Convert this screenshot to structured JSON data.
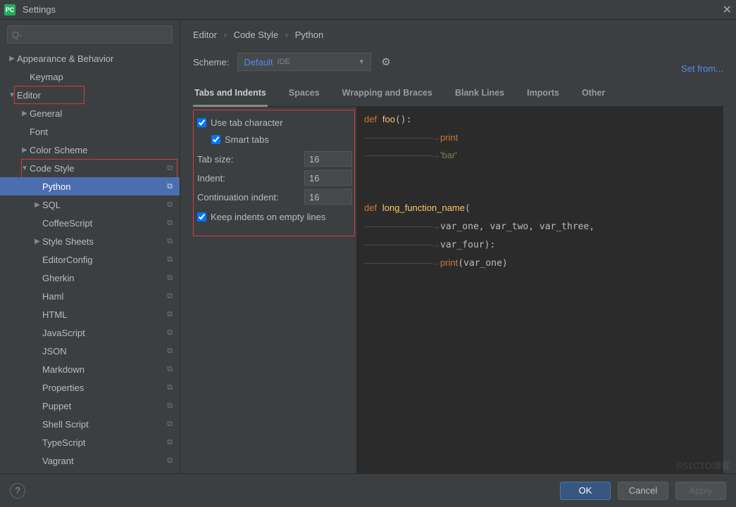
{
  "window": {
    "title": "Settings"
  },
  "search": {
    "placeholder": "Q-"
  },
  "tree": [
    {
      "label": "Appearance & Behavior",
      "depth": 0,
      "arrow": "▶",
      "copy": false,
      "sel": false
    },
    {
      "label": "Keymap",
      "depth": 1,
      "arrow": "",
      "copy": false,
      "sel": false
    },
    {
      "label": "Editor",
      "depth": 0,
      "arrow": "▼",
      "copy": false,
      "sel": false
    },
    {
      "label": "General",
      "depth": 1,
      "arrow": "▶",
      "copy": false,
      "sel": false
    },
    {
      "label": "Font",
      "depth": 1,
      "arrow": "",
      "copy": false,
      "sel": false
    },
    {
      "label": "Color Scheme",
      "depth": 1,
      "arrow": "▶",
      "copy": false,
      "sel": false
    },
    {
      "label": "Code Style",
      "depth": 1,
      "arrow": "▼",
      "copy": true,
      "sel": false
    },
    {
      "label": "Python",
      "depth": 2,
      "arrow": "",
      "copy": true,
      "sel": true
    },
    {
      "label": "SQL",
      "depth": 2,
      "arrow": "▶",
      "copy": true,
      "sel": false
    },
    {
      "label": "CoffeeScript",
      "depth": 2,
      "arrow": "",
      "copy": true,
      "sel": false
    },
    {
      "label": "Style Sheets",
      "depth": 2,
      "arrow": "▶",
      "copy": true,
      "sel": false
    },
    {
      "label": "EditorConfig",
      "depth": 2,
      "arrow": "",
      "copy": true,
      "sel": false
    },
    {
      "label": "Gherkin",
      "depth": 2,
      "arrow": "",
      "copy": true,
      "sel": false
    },
    {
      "label": "Haml",
      "depth": 2,
      "arrow": "",
      "copy": true,
      "sel": false
    },
    {
      "label": "HTML",
      "depth": 2,
      "arrow": "",
      "copy": true,
      "sel": false
    },
    {
      "label": "JavaScript",
      "depth": 2,
      "arrow": "",
      "copy": true,
      "sel": false
    },
    {
      "label": "JSON",
      "depth": 2,
      "arrow": "",
      "copy": true,
      "sel": false
    },
    {
      "label": "Markdown",
      "depth": 2,
      "arrow": "",
      "copy": true,
      "sel": false
    },
    {
      "label": "Properties",
      "depth": 2,
      "arrow": "",
      "copy": true,
      "sel": false
    },
    {
      "label": "Puppet",
      "depth": 2,
      "arrow": "",
      "copy": true,
      "sel": false
    },
    {
      "label": "Shell Script",
      "depth": 2,
      "arrow": "",
      "copy": true,
      "sel": false
    },
    {
      "label": "TypeScript",
      "depth": 2,
      "arrow": "",
      "copy": true,
      "sel": false
    },
    {
      "label": "Vagrant",
      "depth": 2,
      "arrow": "",
      "copy": true,
      "sel": false
    }
  ],
  "breadcrumb": {
    "a": "Editor",
    "b": "Code Style",
    "c": "Python"
  },
  "scheme": {
    "label": "Scheme:",
    "name": "Default",
    "tag": "IDE"
  },
  "set_from": "Set from...",
  "tabs": [
    {
      "label": "Tabs and Indents",
      "active": true
    },
    {
      "label": "Spaces",
      "active": false
    },
    {
      "label": "Wrapping and Braces",
      "active": false
    },
    {
      "label": "Blank Lines",
      "active": false
    },
    {
      "label": "Imports",
      "active": false
    },
    {
      "label": "Other",
      "active": false
    }
  ],
  "opts": {
    "use_tab": {
      "label": "Use tab character",
      "checked": true
    },
    "smart_tabs": {
      "label": "Smart tabs",
      "checked": true
    },
    "tab_size": {
      "label": "Tab size:",
      "value": "16"
    },
    "indent": {
      "label": "Indent:",
      "value": "16"
    },
    "cont_indent": {
      "label": "Continuation indent:",
      "value": "16"
    },
    "keep_empty": {
      "label": "Keep indents on empty lines",
      "checked": true
    }
  },
  "buttons": {
    "ok": "OK",
    "cancel": "Cancel",
    "apply": "Apply"
  },
  "watermark": "©51CTO博客"
}
